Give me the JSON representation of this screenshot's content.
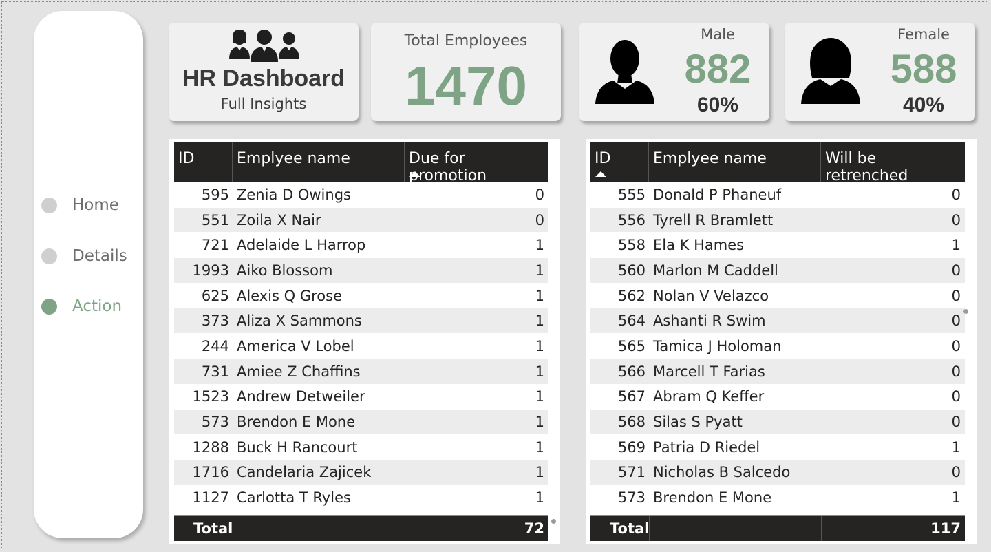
{
  "nav": {
    "items": [
      {
        "label": "Home",
        "active": false
      },
      {
        "label": "Details",
        "active": false
      },
      {
        "label": "Action",
        "active": true
      }
    ]
  },
  "cards": {
    "hr": {
      "title": "HR Dashboard",
      "subtitle": "Full Insights",
      "icon": "people-group-icon"
    },
    "total": {
      "label": "Total Employees",
      "value": "1470"
    },
    "male": {
      "label": "Male",
      "value": "882",
      "percent": "60%",
      "icon": "male-silhouette-icon"
    },
    "female": {
      "label": "Female",
      "value": "588",
      "percent": "40%",
      "icon": "female-silhouette-icon"
    }
  },
  "colors": {
    "accent": "#7fa385",
    "header_bg": "#252423",
    "row_shade": "#ececec"
  },
  "promotion_table": {
    "columns": [
      "ID",
      "Emplyee name",
      "Due for promotion"
    ],
    "sorted_column": "Due for promotion",
    "rows": [
      {
        "id": "595",
        "name": "Zenia D Owings",
        "value": "0"
      },
      {
        "id": "551",
        "name": "Zoila X Nair",
        "value": "0"
      },
      {
        "id": "721",
        "name": "Adelaide L Harrop",
        "value": "1"
      },
      {
        "id": "1993",
        "name": "Aiko Blossom",
        "value": "1"
      },
      {
        "id": "625",
        "name": "Alexis Q Grose",
        "value": "1"
      },
      {
        "id": "373",
        "name": "Aliza X Sammons",
        "value": "1"
      },
      {
        "id": "244",
        "name": "America V Lobel",
        "value": "1"
      },
      {
        "id": "731",
        "name": "Amiee Z Chaffins",
        "value": "1"
      },
      {
        "id": "1523",
        "name": "Andrew Detweiler",
        "value": "1"
      },
      {
        "id": "573",
        "name": "Brendon E Mone",
        "value": "1"
      },
      {
        "id": "1288",
        "name": "Buck H Rancourt",
        "value": "1"
      },
      {
        "id": "1716",
        "name": "Candelaria Zajicek",
        "value": "1"
      },
      {
        "id": "1127",
        "name": "Carlotta T Ryles",
        "value": "1"
      }
    ],
    "total_label": "Total",
    "total_value": "72"
  },
  "retrench_table": {
    "columns": [
      "ID",
      "Emplyee name",
      "Will be retrenched"
    ],
    "sorted_column": "ID",
    "rows": [
      {
        "id": "555",
        "name": "Donald P Phaneuf",
        "value": "0"
      },
      {
        "id": "556",
        "name": "Tyrell R Bramlett",
        "value": "0"
      },
      {
        "id": "558",
        "name": "Ela K Hames",
        "value": "1"
      },
      {
        "id": "560",
        "name": "Marlon M Caddell",
        "value": "0"
      },
      {
        "id": "562",
        "name": "Nolan V Velazco",
        "value": "0"
      },
      {
        "id": "564",
        "name": "Ashanti R Swim",
        "value": "0"
      },
      {
        "id": "565",
        "name": "Tamica J Holoman",
        "value": "0"
      },
      {
        "id": "566",
        "name": "Marcell T Farias",
        "value": "0"
      },
      {
        "id": "567",
        "name": "Abram Q Keffer",
        "value": "0"
      },
      {
        "id": "568",
        "name": "Silas S Pyatt",
        "value": "0"
      },
      {
        "id": "569",
        "name": "Patria D Riedel",
        "value": "1"
      },
      {
        "id": "571",
        "name": "Nicholas B Salcedo",
        "value": "0"
      },
      {
        "id": "573",
        "name": "Brendon E Mone",
        "value": "1"
      }
    ],
    "total_label": "Total",
    "total_value": "117"
  }
}
